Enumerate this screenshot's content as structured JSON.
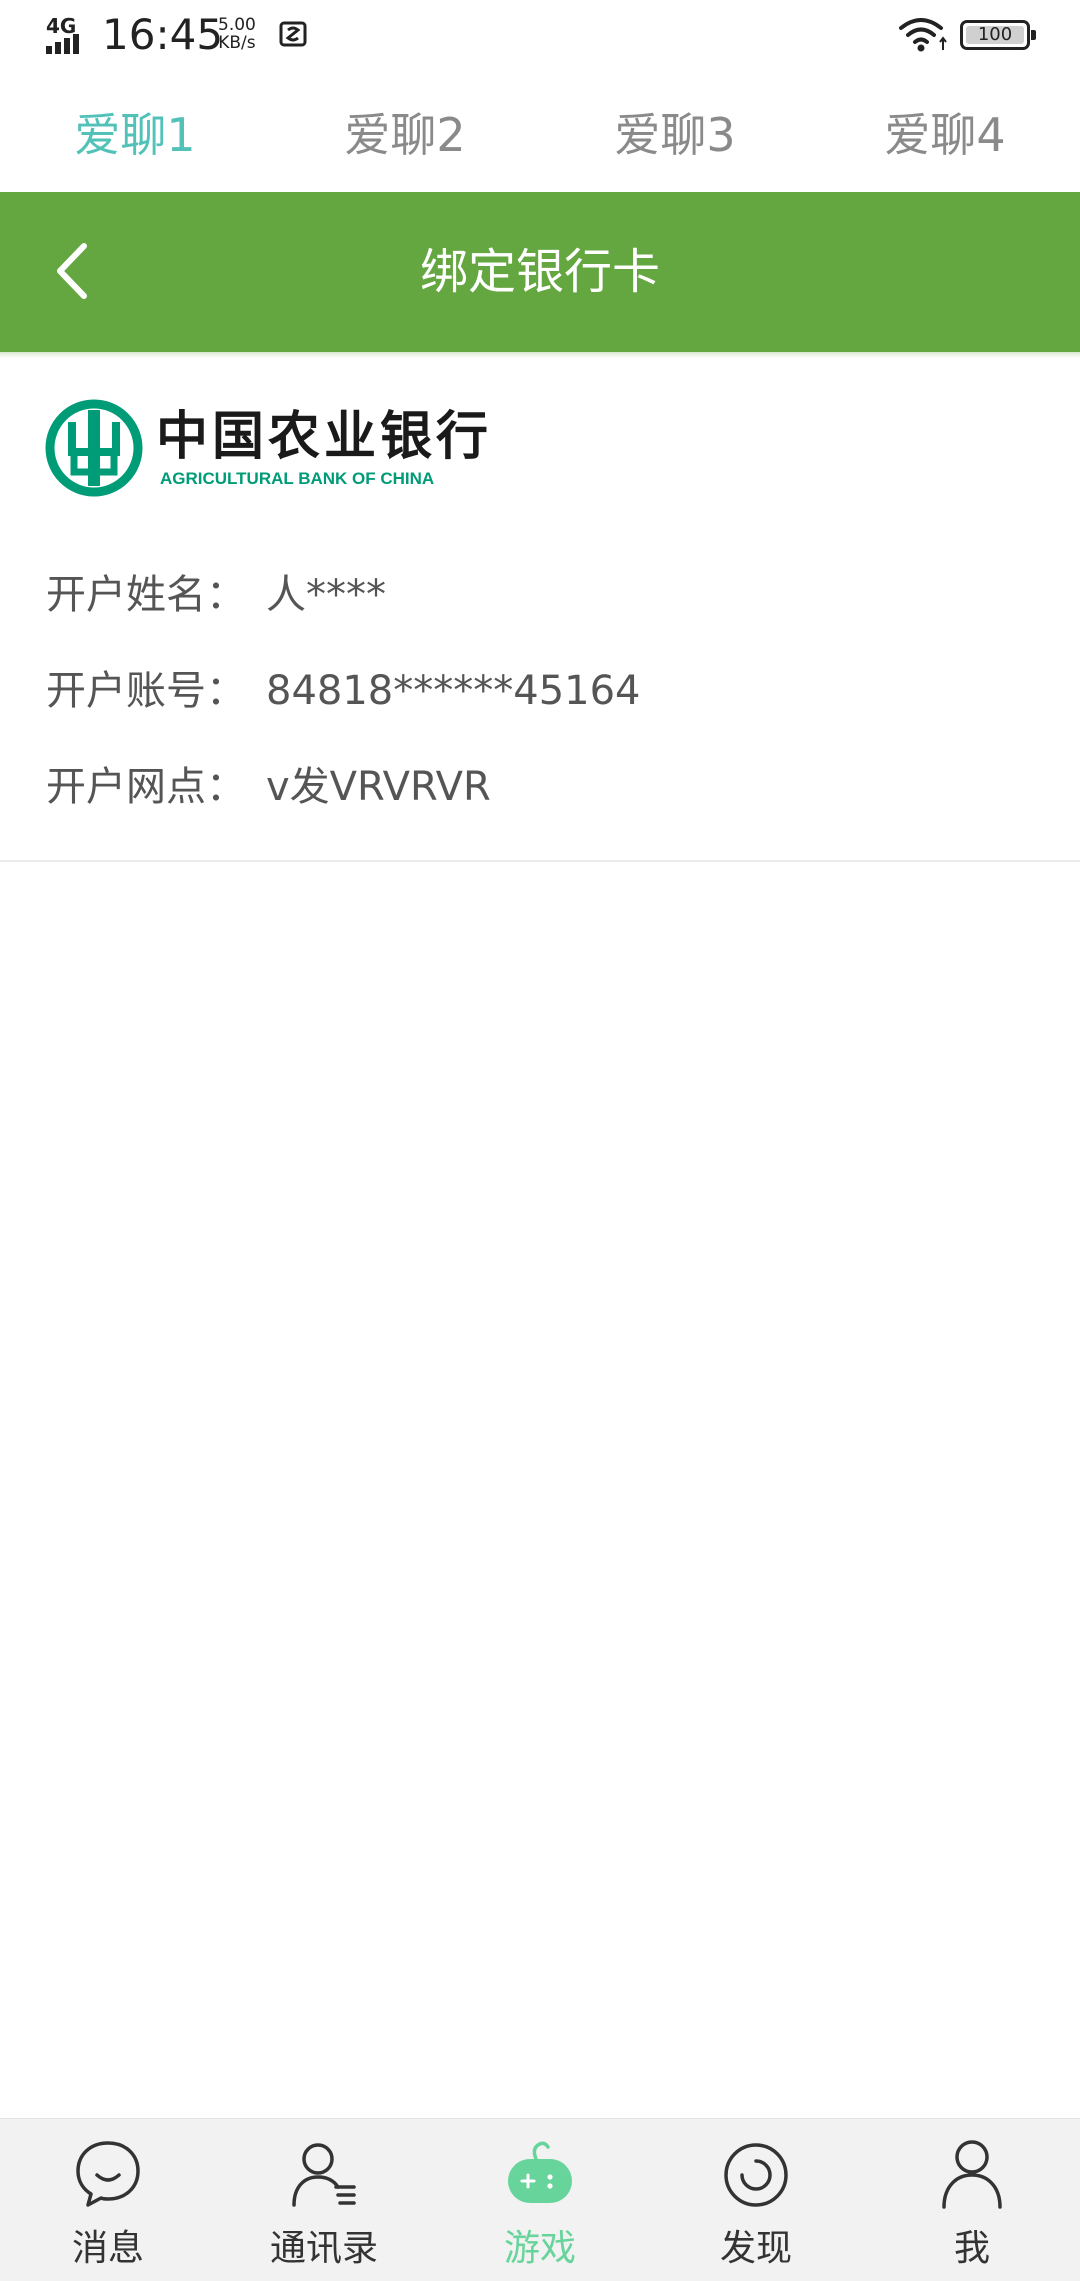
{
  "status_bar": {
    "network": "4G",
    "time": "16:45",
    "speed_value": "5.00",
    "speed_unit": "KB/s",
    "battery": "100"
  },
  "top_tabs": [
    {
      "label": "爱聊1",
      "active": true
    },
    {
      "label": "爱聊2",
      "active": false
    },
    {
      "label": "爱聊3",
      "active": false
    },
    {
      "label": "爱聊4",
      "active": false
    }
  ],
  "header": {
    "title": "绑定银行卡",
    "color": "#64a640"
  },
  "bank": {
    "name_cn": "中国农业银行",
    "name_en": "AGRICULTURAL BANK OF CHINA",
    "logo_color": "#009b77",
    "fields": [
      {
        "label": "开户姓名：",
        "value": "人****"
      },
      {
        "label": "开户账号：",
        "value": "84818******45164"
      },
      {
        "label": "开户网点：",
        "value": "v发VRVRVR"
      }
    ]
  },
  "bottom_nav": [
    {
      "label": "消息",
      "icon": "chat-bubble-icon",
      "active": false
    },
    {
      "label": "通讯录",
      "icon": "contacts-icon",
      "active": false
    },
    {
      "label": "游戏",
      "icon": "gamepad-icon",
      "active": true
    },
    {
      "label": "发现",
      "icon": "discover-icon",
      "active": false
    },
    {
      "label": "我",
      "icon": "profile-icon",
      "active": false
    }
  ],
  "colors": {
    "tab_active": "#52c2b8",
    "nav_active": "#67d49b"
  }
}
